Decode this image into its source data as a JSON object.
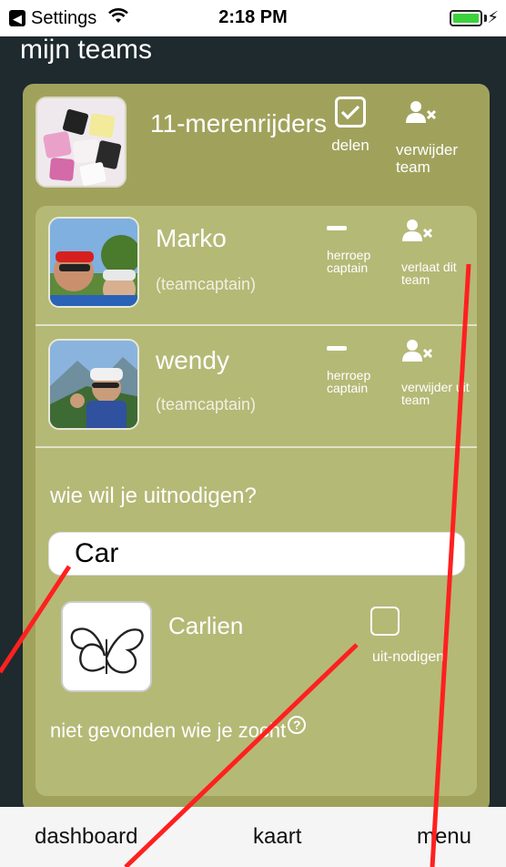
{
  "status_bar": {
    "back_app": "Settings",
    "time": "2:18 PM"
  },
  "page": {
    "title": "mijn teams"
  },
  "team": {
    "name": "11-merenrijders",
    "share_label": "delen",
    "remove_team_label": "verwijder team",
    "share_checked": true
  },
  "members": [
    {
      "name": "Marko",
      "role": "(teamcaptain)",
      "revoke_label": "herroep captain",
      "action_label": "verlaat dit team"
    },
    {
      "name": "wendy",
      "role": "(teamcaptain)",
      "revoke_label": "herroep captain",
      "action_label": "verwijder uit team"
    }
  ],
  "invite": {
    "prompt": "wie wil je uitnodigen?",
    "search_value": "Car",
    "result": {
      "name": "Carlien",
      "invite_label": "uit-nodigen",
      "checked": false
    },
    "not_found": "niet gevonden wie je zocht",
    "help_glyph": "?"
  },
  "tabbar": {
    "items": [
      "dashboard",
      "kaart",
      "menu"
    ]
  },
  "colors": {
    "background": "#1e2a2e",
    "team_card": "#a0a25c",
    "members_card": "#b5b976",
    "annotation_line": "#ff2020"
  },
  "icons": [
    "back-icon",
    "wifi-icon",
    "battery-icon",
    "checkbox-checked-icon",
    "remove-user-icon",
    "minus-icon",
    "help-icon"
  ]
}
